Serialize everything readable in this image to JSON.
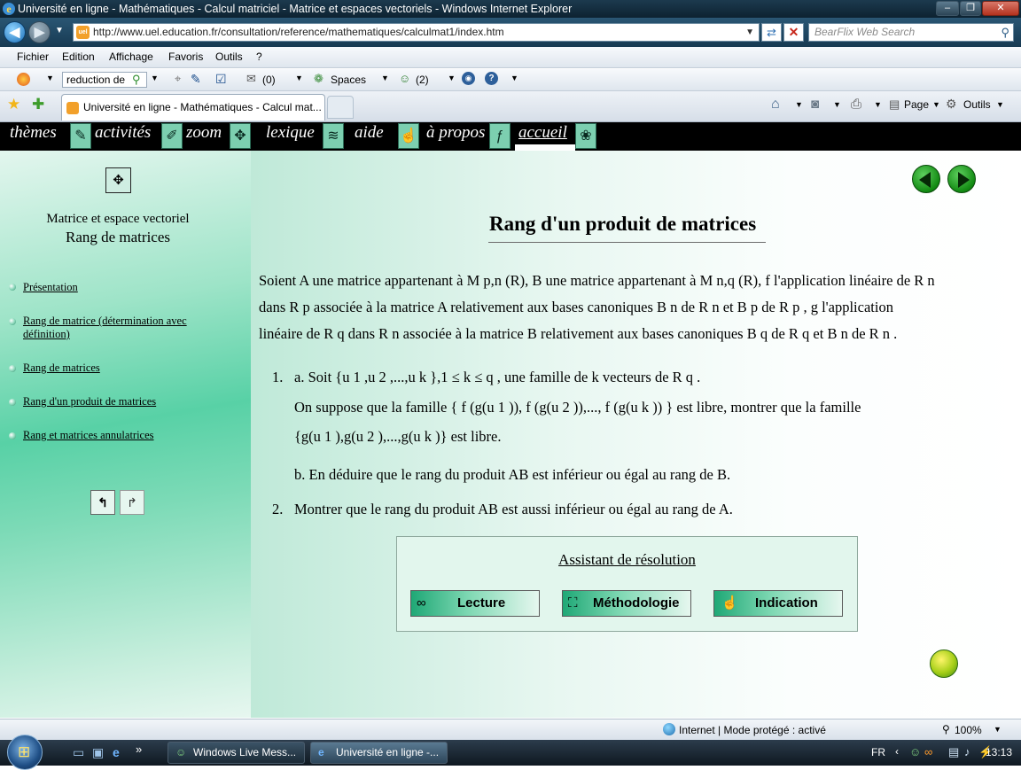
{
  "window": {
    "title": "Université en ligne - Mathématiques - Calcul matriciel - Matrice et espaces vectoriels - Windows Internet Explorer"
  },
  "address": {
    "url": "http://www.uel.education.fr/consultation/reference/mathematiques/calculmat1/index.htm"
  },
  "search": {
    "placeholder": "BearFlix Web Search"
  },
  "menu": [
    "Fichier",
    "Edition",
    "Affichage",
    "Favoris",
    "Outils",
    "?"
  ],
  "toolbar2": {
    "search_value": "reduction de",
    "mail_count": "(0)",
    "spaces": "Spaces",
    "contacts_count": "(2)"
  },
  "tab": {
    "label": "Université en ligne - Mathématiques - Calcul mat..."
  },
  "commandbar": {
    "page": "Page",
    "tools": "Outils"
  },
  "sitenav": [
    "thèmes",
    "activités",
    "zoom",
    "lexique",
    "aide",
    "à propos",
    "accueil"
  ],
  "sidebar": {
    "subtitle": "Matrice et espace vectoriel",
    "title": "Rang de matrices",
    "links": [
      "Présentation",
      "Rang de matrice (détermination avec",
      "définition)",
      "Rang de matrices",
      "Rang d'un produit de matrices",
      "Rang et matrices annulatrices"
    ]
  },
  "content": {
    "title": "Rang d'un produit de matrices",
    "intro_l1": "Soient A une matrice appartenant à M p,n (R), B une matrice appartenant à M n,q (R), f l'application linéaire de R n",
    "intro_l2": "dans R p associée à la matrice A relativement aux bases canoniques B n de R n et B p de R p , g l'application",
    "intro_l3": "linéaire de R q dans R n associée à la matrice B relativement aux bases canoniques B q de R q et B n de R n .",
    "q1_num": "1.",
    "q1a_l1": "a. Soit {u 1 ,u 2 ,...,u k },1 ≤ k ≤ q , une famille de k vecteurs de R q .",
    "q1a_l2": "On suppose que la famille { f (g(u 1 )), f (g(u 2 )),..., f (g(u k )) } est libre, montrer que la famille",
    "q1a_l3": "{g(u 1 ),g(u 2 ),...,g(u k )} est libre.",
    "q1b": "b. En déduire que le rang du produit AB est inférieur ou égal au rang de B.",
    "q2_num": "2.",
    "q2": "Montrer que le rang du produit AB est aussi inférieur ou égal au rang de A."
  },
  "assistant": {
    "title": "Assistant de résolution",
    "buttons": [
      "Lecture",
      "Méthodologie",
      "Indication"
    ]
  },
  "statusbar": {
    "zone": "Internet | Mode protégé : activé",
    "zoom": "100%"
  },
  "taskbar": {
    "items": [
      "Windows Live Mess...",
      "Université en ligne -..."
    ],
    "lang": "FR",
    "time": "13:13"
  }
}
